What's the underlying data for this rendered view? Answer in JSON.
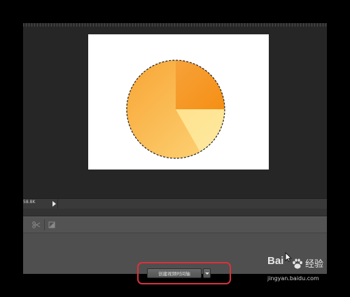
{
  "status_bar": {
    "zoom": "58.8K"
  },
  "timeline": {
    "tools": [
      {
        "name": "scissors-icon"
      },
      {
        "name": "transition-icon"
      }
    ],
    "create_button_label": "创建视频时间轴"
  },
  "canvas": {
    "pie_colors": {
      "dark": "#f7901e",
      "light": "#fde48a"
    },
    "selection": "marching-ants-circle"
  },
  "colors": {
    "highlight": "#d8323a",
    "panel_bg": "#4f4f4f",
    "canvas_bg": "#262626"
  },
  "watermark": {
    "brand": "Bai",
    "brand_suffix": "经验",
    "url": "jingyan.baidu.com"
  }
}
